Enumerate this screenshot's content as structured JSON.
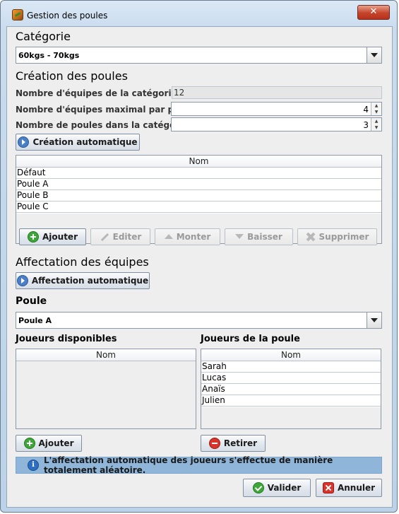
{
  "window": {
    "title": "Gestion des poules",
    "close_glyph": "✕"
  },
  "categorie": {
    "section_title": "Catégorie",
    "selected": "60kgs - 70kgs"
  },
  "creation": {
    "section_title": "Création des poules",
    "nb_equipes_label": "Nombre d'équipes de la catégorie :",
    "nb_equipes_value": "12",
    "max_par_poule_label": "Nombre d'équipes maximal par poule :",
    "max_par_poule_value": "4",
    "nb_poules_label": "Nombre de poules dans la catégorie :",
    "nb_poules_value": "3",
    "auto_button": "Création automatique",
    "table_header": "Nom",
    "poules": [
      "Défaut",
      "Poule A",
      "Poule B",
      "Poule C"
    ],
    "buttons": {
      "ajouter": "Ajouter",
      "editer": "Editer",
      "monter": "Monter",
      "baisser": "Baisser",
      "supprimer": "Supprimer"
    }
  },
  "affectation": {
    "section_title": "Affectation des équipes",
    "auto_button": "Affectation automatique",
    "poule_label": "Poule",
    "poule_selected": "Poule A",
    "disponibles_title": "Joueurs disponibles",
    "disponibles_header": "Nom",
    "disponibles": [],
    "poule_title": "Joueurs de la poule",
    "poule_header": "Nom",
    "joueurs_poule": [
      "Sarah",
      "Lucas",
      "Anaïs",
      "Julien"
    ],
    "ajouter_button": "Ajouter",
    "retirer_button": "Retirer",
    "info_text": "L'affectation automatique des joueurs s'effectue de manière totalement aléatoire."
  },
  "footer": {
    "valider": "Valider",
    "annuler": "Annuler"
  }
}
